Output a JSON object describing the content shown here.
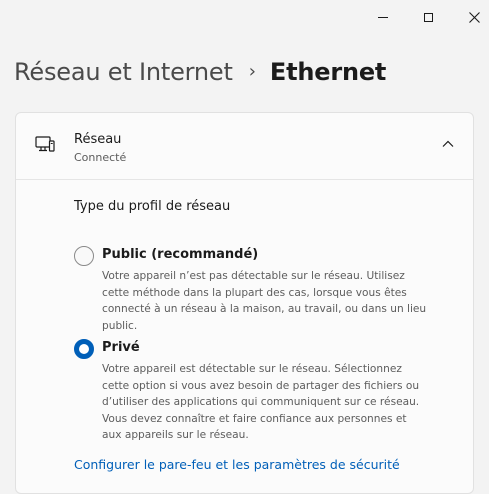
{
  "window": {
    "minimize_icon": "minimize-icon",
    "maximize_icon": "maximize-icon",
    "close_icon": "close-icon"
  },
  "breadcrumb": {
    "parent": "Réseau et Internet",
    "separator": "›",
    "current": "Ethernet"
  },
  "network_card": {
    "icon": "network-computer-icon",
    "title": "Réseau",
    "status": "Connecté",
    "expanded": true,
    "profile_label": "Type du profil de réseau",
    "options": [
      {
        "title": "Public (recommandé)",
        "selected": false,
        "description": [
          "Votre appareil n’est pas détectable sur le réseau. Utilisez",
          "cette méthode dans la plupart des cas, lorsque vous êtes",
          "connecté à un réseau à la maison, au travail, ou dans un lieu",
          "public."
        ]
      },
      {
        "title": "Privé",
        "selected": true,
        "description": [
          "Votre appareil est détectable sur le réseau. Sélectionnez",
          "cette option si vous avez besoin de partager des fichiers ou",
          "d’utiliser des applications qui communiquent sur ce réseau.",
          "Vous devez connaître et faire confiance aux personnes et",
          "aux appareils sur le réseau."
        ]
      }
    ],
    "link": "Configurer le pare-feu et les paramètres de sécurité"
  },
  "colors": {
    "accent": "#005fb8",
    "background": "#f3f3f3",
    "card": "#fbfbfb"
  }
}
